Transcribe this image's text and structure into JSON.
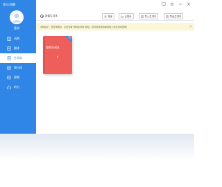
{
  "app": {
    "title": "金山词霸"
  },
  "user": {
    "login_label": "登录"
  },
  "nav": {
    "items": [
      {
        "label": "词典",
        "icon": "book-icon",
        "active": false
      },
      {
        "label": "翻译",
        "icon": "translate-icon",
        "active": false
      },
      {
        "label": "生词本",
        "icon": "notebook-icon",
        "active": true
      },
      {
        "label": "每日读",
        "icon": "reading-icon",
        "active": false
      },
      {
        "label": "视频",
        "icon": "video-icon",
        "active": false
      },
      {
        "label": "听力",
        "icon": "headphones-icon",
        "active": false
      }
    ]
  },
  "toolbar": {
    "new_label": "新建生词本",
    "sort_label": "排序",
    "sync_label": "云同步",
    "import_label": "导入生词本",
    "export_label": "导出生词本"
  },
  "notice": {
    "text": "添加提示：查查词典时，点击查看“添加生词本”按钮，即可将添加的单词加入到生词本里哦！"
  },
  "wordbook": {
    "title": "我的生词本",
    "count": "0",
    "ribbon": "默认"
  },
  "colors": {
    "sidebar": "#2f86e6",
    "book": "#ee5f5b",
    "notice_bg": "#fbf6d4"
  }
}
